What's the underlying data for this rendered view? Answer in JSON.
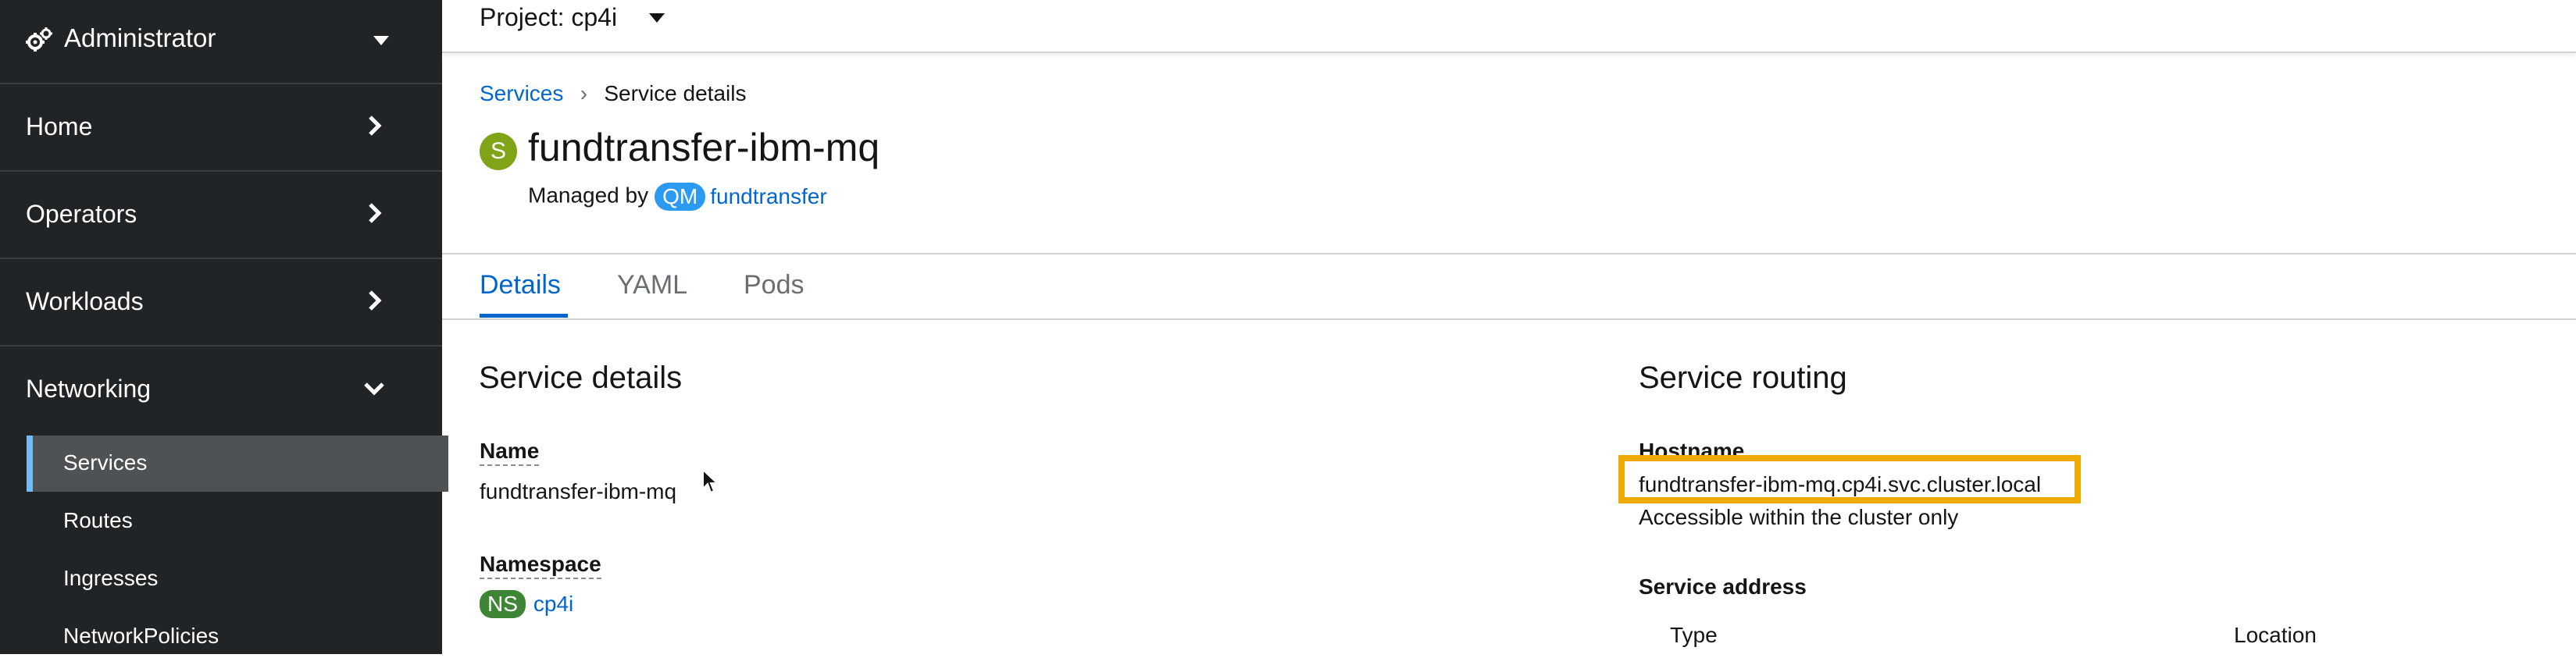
{
  "sidebar": {
    "perspective": {
      "label": "Administrator",
      "icon": "gears-icon"
    },
    "items": [
      {
        "label": "Home",
        "expanded": false
      },
      {
        "label": "Operators",
        "expanded": false
      },
      {
        "label": "Workloads",
        "expanded": false
      },
      {
        "label": "Networking",
        "expanded": true
      }
    ],
    "networking_sub": [
      {
        "label": "Services",
        "active": true
      },
      {
        "label": "Routes",
        "active": false
      },
      {
        "label": "Ingresses",
        "active": false
      },
      {
        "label": "NetworkPolicies",
        "active": false
      }
    ]
  },
  "project_bar": {
    "label": "Project: cp4i"
  },
  "breadcrumb": {
    "parent": "Services",
    "current": "Service details"
  },
  "resource": {
    "badge": "S",
    "name": "fundtransfer-ibm-mq",
    "managed_by_label": "Managed by",
    "owner_badge": "QM",
    "owner_name": "fundtransfer"
  },
  "tabs": [
    {
      "label": "Details",
      "active": true
    },
    {
      "label": "YAML",
      "active": false
    },
    {
      "label": "Pods",
      "active": false
    }
  ],
  "details": {
    "heading": "Service details",
    "name_label": "Name",
    "name_value": "fundtransfer-ibm-mq",
    "namespace_label": "Namespace",
    "namespace_badge": "NS",
    "namespace_value": "cp4i"
  },
  "routing": {
    "heading": "Service routing",
    "hostname_label": "Hostname",
    "hostname_value": "fundtransfer-ibm-mq.cp4i.svc.cluster.local",
    "hostname_note": "Accessible within the cluster only",
    "address_label": "Service address",
    "columns": [
      "Type",
      "Location"
    ]
  },
  "colors": {
    "sidebar_bg": "#212427",
    "active_accent": "#73bcf7",
    "link": "#0066cc",
    "highlight": "#f0ab00",
    "service_badge": "#7fa417",
    "namespace_badge": "#3e8635",
    "qm_badge": "#2b9af3"
  }
}
